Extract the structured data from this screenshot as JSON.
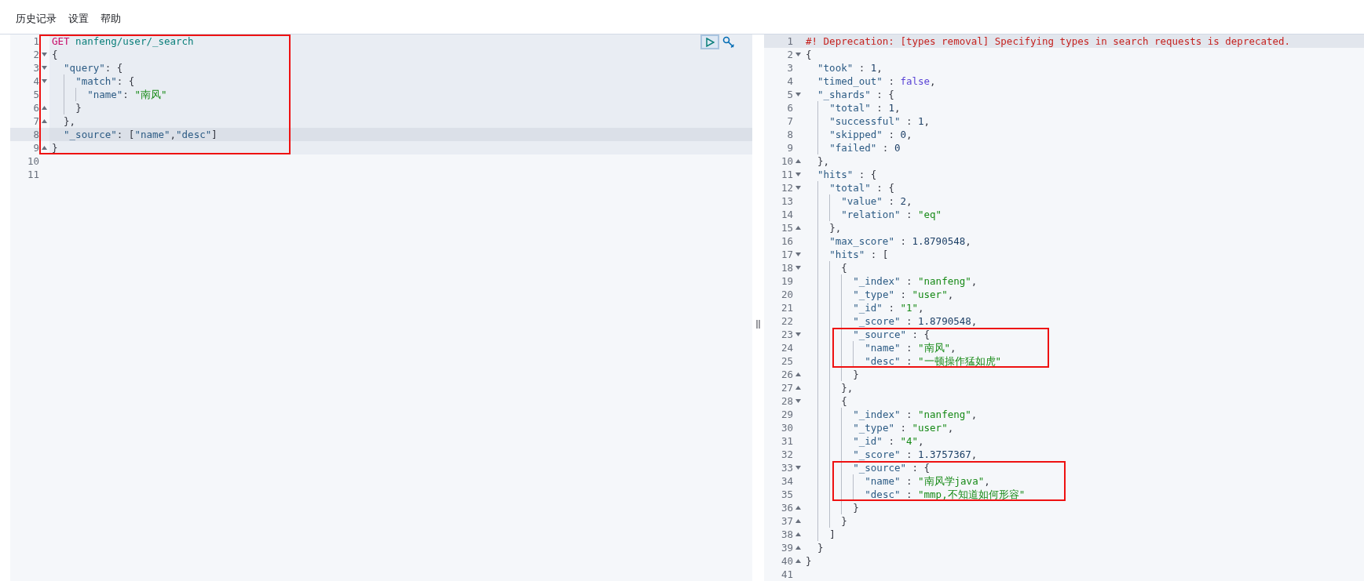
{
  "menu": [
    {
      "label": "历史记录"
    },
    {
      "label": "设置"
    },
    {
      "label": "帮助"
    }
  ],
  "request_panel": {
    "lines": [
      {
        "kind": "framed_group",
        "lines": [
          {
            "kind": "line",
            "number": "1",
            "fold_start": false,
            "fold_end": false,
            "active_block": true,
            "cursor": false,
            "tokens": [
              {
                "kind": "method",
                "text": "GET"
              },
              {
                "kind": "url",
                "text": " nanfeng/user/_search"
              }
            ]
          },
          {
            "kind": "line",
            "number": "2",
            "fold_start": true,
            "fold_end": false,
            "active_block": true,
            "cursor": false,
            "tokens": [
              {
                "kind": "punct",
                "text": "{"
              }
            ]
          },
          {
            "kind": "line",
            "number": "3",
            "fold_start": true,
            "fold_end": false,
            "active_block": true,
            "cursor": false,
            "tokens": [
              {
                "kind": "key",
                "text": "\"query\""
              },
              {
                "kind": "punct",
                "text": ": {"
              }
            ]
          },
          {
            "kind": "line",
            "number": "4",
            "fold_start": true,
            "fold_end": false,
            "active_block": true,
            "cursor": false,
            "tokens": [
              {
                "kind": "key",
                "text": "\"match\""
              },
              {
                "kind": "punct",
                "text": ": {"
              }
            ]
          },
          {
            "kind": "line",
            "number": "5",
            "fold_start": false,
            "fold_end": false,
            "active_block": true,
            "cursor": false,
            "tokens": [
              {
                "kind": "key",
                "text": "\"name\""
              },
              {
                "kind": "punct",
                "text": ": "
              },
              {
                "kind": "string",
                "text": "\"南风\""
              }
            ]
          },
          {
            "kind": "line",
            "number": "6",
            "fold_start": false,
            "fold_end": true,
            "active_block": true,
            "cursor": false,
            "tokens": [
              {
                "kind": "punct",
                "text": "}"
              }
            ]
          },
          {
            "kind": "line",
            "number": "7",
            "fold_start": false,
            "fold_end": true,
            "active_block": true,
            "cursor": false,
            "tokens": [
              {
                "kind": "punct",
                "text": "},"
              }
            ]
          },
          {
            "kind": "line",
            "number": "8",
            "fold_start": false,
            "fold_end": false,
            "active_block": true,
            "cursor": true,
            "tokens": [
              {
                "kind": "key",
                "text": "\"_source\""
              },
              {
                "kind": "punct",
                "text": ": ["
              },
              {
                "kind": "key",
                "text": "\"name\""
              },
              {
                "kind": "punct",
                "text": ","
              },
              {
                "kind": "key",
                "text": "\"desc\""
              },
              {
                "kind": "punct",
                "text": "]"
              }
            ]
          },
          {
            "kind": "line",
            "number": "9",
            "fold_start": false,
            "fold_end": true,
            "active_block": true,
            "cursor": false,
            "tokens": [
              {
                "kind": "punct",
                "text": "}"
              }
            ]
          }
        ]
      },
      {
        "kind": "line",
        "number": "10",
        "fold_start": false,
        "fold_end": false,
        "active_block": false,
        "cursor": false
      },
      {
        "kind": "line",
        "number": "11",
        "fold_start": false,
        "fold_end": false,
        "active_block": false,
        "cursor": false
      }
    ]
  },
  "response_panel": {
    "lines": [
      {
        "kind": "line",
        "number": "1",
        "fold_start": false,
        "fold_end": false,
        "active_block": false,
        "cursor": true,
        "tokens": [
          {
            "kind": "comment",
            "text": "#! Deprecation: [types removal] Specifying types in search requests is deprecated."
          }
        ]
      },
      {
        "kind": "line",
        "number": "2",
        "fold_start": true,
        "fold_end": false,
        "active_block": false,
        "cursor": false,
        "tokens": [
          {
            "kind": "punct",
            "text": "{"
          }
        ]
      },
      {
        "kind": "line",
        "number": "3",
        "fold_start": false,
        "fold_end": false,
        "active_block": false,
        "cursor": false,
        "tokens": [
          {
            "kind": "key",
            "text": "\"took\""
          },
          {
            "kind": "punct",
            "text": " : "
          },
          {
            "kind": "number",
            "text": "1"
          },
          {
            "kind": "punct",
            "text": ","
          }
        ]
      },
      {
        "kind": "line",
        "number": "4",
        "fold_start": false,
        "fold_end": false,
        "active_block": false,
        "cursor": false,
        "tokens": [
          {
            "kind": "key",
            "text": "\"timed_out\""
          },
          {
            "kind": "punct",
            "text": " : "
          },
          {
            "kind": "bool",
            "text": "false"
          },
          {
            "kind": "punct",
            "text": ","
          }
        ]
      },
      {
        "kind": "line",
        "number": "5",
        "fold_start": true,
        "fold_end": false,
        "active_block": false,
        "cursor": false,
        "tokens": [
          {
            "kind": "key",
            "text": "\"_shards\""
          },
          {
            "kind": "punct",
            "text": " : {"
          }
        ]
      },
      {
        "kind": "line",
        "number": "6",
        "fold_start": false,
        "fold_end": false,
        "active_block": false,
        "cursor": false,
        "tokens": [
          {
            "kind": "key",
            "text": "\"total\""
          },
          {
            "kind": "punct",
            "text": " : "
          },
          {
            "kind": "number",
            "text": "1"
          },
          {
            "kind": "punct",
            "text": ","
          }
        ]
      },
      {
        "kind": "line",
        "number": "7",
        "fold_start": false,
        "fold_end": false,
        "active_block": false,
        "cursor": false,
        "tokens": [
          {
            "kind": "key",
            "text": "\"successful\""
          },
          {
            "kind": "punct",
            "text": " : "
          },
          {
            "kind": "number",
            "text": "1"
          },
          {
            "kind": "punct",
            "text": ","
          }
        ]
      },
      {
        "kind": "line",
        "number": "8",
        "fold_start": false,
        "fold_end": false,
        "active_block": false,
        "cursor": false,
        "tokens": [
          {
            "kind": "key",
            "text": "\"skipped\""
          },
          {
            "kind": "punct",
            "text": " : "
          },
          {
            "kind": "number",
            "text": "0"
          },
          {
            "kind": "punct",
            "text": ","
          }
        ]
      },
      {
        "kind": "line",
        "number": "9",
        "fold_start": false,
        "fold_end": false,
        "active_block": false,
        "cursor": false,
        "tokens": [
          {
            "kind": "key",
            "text": "\"failed\""
          },
          {
            "kind": "punct",
            "text": " : "
          },
          {
            "kind": "number",
            "text": "0"
          }
        ]
      },
      {
        "kind": "line",
        "number": "10",
        "fold_start": false,
        "fold_end": true,
        "active_block": false,
        "cursor": false,
        "tokens": [
          {
            "kind": "punct",
            "text": "},"
          }
        ]
      },
      {
        "kind": "line",
        "number": "11",
        "fold_start": true,
        "fold_end": false,
        "active_block": false,
        "cursor": false,
        "tokens": [
          {
            "kind": "key",
            "text": "\"hits\""
          },
          {
            "kind": "punct",
            "text": " : {"
          }
        ]
      },
      {
        "kind": "line",
        "number": "12",
        "fold_start": true,
        "fold_end": false,
        "active_block": false,
        "cursor": false,
        "tokens": [
          {
            "kind": "key",
            "text": "\"total\""
          },
          {
            "kind": "punct",
            "text": " : {"
          }
        ]
      },
      {
        "kind": "line",
        "number": "13",
        "fold_start": false,
        "fold_end": false,
        "active_block": false,
        "cursor": false,
        "tokens": [
          {
            "kind": "key",
            "text": "\"value\""
          },
          {
            "kind": "punct",
            "text": " : "
          },
          {
            "kind": "number",
            "text": "2"
          },
          {
            "kind": "punct",
            "text": ","
          }
        ]
      },
      {
        "kind": "line",
        "number": "14",
        "fold_start": false,
        "fold_end": false,
        "active_block": false,
        "cursor": false,
        "tokens": [
          {
            "kind": "key",
            "text": "\"relation\""
          },
          {
            "kind": "punct",
            "text": " : "
          },
          {
            "kind": "string",
            "text": "\"eq\""
          }
        ]
      },
      {
        "kind": "line",
        "number": "15",
        "fold_start": false,
        "fold_end": true,
        "active_block": false,
        "cursor": false,
        "tokens": [
          {
            "kind": "punct",
            "text": "},"
          }
        ]
      },
      {
        "kind": "line",
        "number": "16",
        "fold_start": false,
        "fold_end": false,
        "active_block": false,
        "cursor": false,
        "tokens": [
          {
            "kind": "key",
            "text": "\"max_score\""
          },
          {
            "kind": "punct",
            "text": " : "
          },
          {
            "kind": "number",
            "text": "1.8790548"
          },
          {
            "kind": "punct",
            "text": ","
          }
        ]
      },
      {
        "kind": "line",
        "number": "17",
        "fold_start": true,
        "fold_end": false,
        "active_block": false,
        "cursor": false,
        "tokens": [
          {
            "kind": "key",
            "text": "\"hits\""
          },
          {
            "kind": "punct",
            "text": " : ["
          }
        ]
      },
      {
        "kind": "line",
        "number": "18",
        "fold_start": true,
        "fold_end": false,
        "active_block": false,
        "cursor": false,
        "tokens": [
          {
            "kind": "punct",
            "text": "{"
          }
        ]
      },
      {
        "kind": "line",
        "number": "19",
        "fold_start": false,
        "fold_end": false,
        "active_block": false,
        "cursor": false,
        "tokens": [
          {
            "kind": "key",
            "text": "\"_index\""
          },
          {
            "kind": "punct",
            "text": " : "
          },
          {
            "kind": "string",
            "text": "\"nanfeng\""
          },
          {
            "kind": "punct",
            "text": ","
          }
        ]
      },
      {
        "kind": "line",
        "number": "20",
        "fold_start": false,
        "fold_end": false,
        "active_block": false,
        "cursor": false,
        "tokens": [
          {
            "kind": "key",
            "text": "\"_type\""
          },
          {
            "kind": "punct",
            "text": " : "
          },
          {
            "kind": "string",
            "text": "\"user\""
          },
          {
            "kind": "punct",
            "text": ","
          }
        ]
      },
      {
        "kind": "line",
        "number": "21",
        "fold_start": false,
        "fold_end": false,
        "active_block": false,
        "cursor": false,
        "tokens": [
          {
            "kind": "key",
            "text": "\"_id\""
          },
          {
            "kind": "punct",
            "text": " : "
          },
          {
            "kind": "string",
            "text": "\"1\""
          },
          {
            "kind": "punct",
            "text": ","
          }
        ]
      },
      {
        "kind": "line",
        "number": "22",
        "fold_start": false,
        "fold_end": false,
        "active_block": false,
        "cursor": false,
        "tokens": [
          {
            "kind": "key",
            "text": "\"_score\""
          },
          {
            "kind": "punct",
            "text": " : "
          },
          {
            "kind": "number",
            "text": "1.8790548"
          },
          {
            "kind": "punct",
            "text": ","
          }
        ]
      },
      {
        "kind": "framed_group",
        "lines": [
          {
            "kind": "line",
            "number": "23",
            "fold_start": true,
            "fold_end": false,
            "active_block": false,
            "cursor": false,
            "tokens": [
              {
                "kind": "key",
                "text": "\"_source\""
              },
              {
                "kind": "punct",
                "text": " : {"
              }
            ]
          },
          {
            "kind": "line",
            "number": "24",
            "fold_start": false,
            "fold_end": false,
            "active_block": false,
            "cursor": false,
            "tokens": [
              {
                "kind": "key",
                "text": "\"name\""
              },
              {
                "kind": "punct",
                "text": " : "
              },
              {
                "kind": "string",
                "text": "\"南风\""
              },
              {
                "kind": "punct",
                "text": ","
              }
            ]
          },
          {
            "kind": "line",
            "number": "25",
            "fold_start": false,
            "fold_end": false,
            "active_block": false,
            "cursor": false,
            "tokens": [
              {
                "kind": "key",
                "text": "\"desc\""
              },
              {
                "kind": "punct",
                "text": " : "
              },
              {
                "kind": "string",
                "text": "\"一顿操作猛如虎\""
              }
            ]
          }
        ]
      },
      {
        "kind": "line",
        "number": "26",
        "fold_start": false,
        "fold_end": true,
        "active_block": false,
        "cursor": false,
        "tokens": [
          {
            "kind": "punct",
            "text": "}"
          }
        ]
      },
      {
        "kind": "line",
        "number": "27",
        "fold_start": false,
        "fold_end": true,
        "active_block": false,
        "cursor": false,
        "tokens": [
          {
            "kind": "punct",
            "text": "},"
          }
        ]
      },
      {
        "kind": "line",
        "number": "28",
        "fold_start": true,
        "fold_end": false,
        "active_block": false,
        "cursor": false,
        "tokens": [
          {
            "kind": "punct",
            "text": "{"
          }
        ]
      },
      {
        "kind": "line",
        "number": "29",
        "fold_start": false,
        "fold_end": false,
        "active_block": false,
        "cursor": false,
        "tokens": [
          {
            "kind": "key",
            "text": "\"_index\""
          },
          {
            "kind": "punct",
            "text": " : "
          },
          {
            "kind": "string",
            "text": "\"nanfeng\""
          },
          {
            "kind": "punct",
            "text": ","
          }
        ]
      },
      {
        "kind": "line",
        "number": "30",
        "fold_start": false,
        "fold_end": false,
        "active_block": false,
        "cursor": false,
        "tokens": [
          {
            "kind": "key",
            "text": "\"_type\""
          },
          {
            "kind": "punct",
            "text": " : "
          },
          {
            "kind": "string",
            "text": "\"user\""
          },
          {
            "kind": "punct",
            "text": ","
          }
        ]
      },
      {
        "kind": "line",
        "number": "31",
        "fold_start": false,
        "fold_end": false,
        "active_block": false,
        "cursor": false,
        "tokens": [
          {
            "kind": "key",
            "text": "\"_id\""
          },
          {
            "kind": "punct",
            "text": " : "
          },
          {
            "kind": "string",
            "text": "\"4\""
          },
          {
            "kind": "punct",
            "text": ","
          }
        ]
      },
      {
        "kind": "line",
        "number": "32",
        "fold_start": false,
        "fold_end": false,
        "active_block": false,
        "cursor": false,
        "tokens": [
          {
            "kind": "key",
            "text": "\"_score\""
          },
          {
            "kind": "punct",
            "text": " : "
          },
          {
            "kind": "number",
            "text": "1.3757367"
          },
          {
            "kind": "punct",
            "text": ","
          }
        ]
      },
      {
        "kind": "framed_group",
        "lines": [
          {
            "kind": "line",
            "number": "33",
            "fold_start": true,
            "fold_end": false,
            "active_block": false,
            "cursor": false,
            "tokens": [
              {
                "kind": "key",
                "text": "\"_source\""
              },
              {
                "kind": "punct",
                "text": " : {"
              }
            ]
          },
          {
            "kind": "line",
            "number": "34",
            "fold_start": false,
            "fold_end": false,
            "active_block": false,
            "cursor": false,
            "tokens": [
              {
                "kind": "key",
                "text": "\"name\""
              },
              {
                "kind": "punct",
                "text": " : "
              },
              {
                "kind": "string",
                "text": "\"南风学java\""
              },
              {
                "kind": "punct",
                "text": ","
              }
            ]
          },
          {
            "kind": "line",
            "number": "35",
            "fold_start": false,
            "fold_end": false,
            "active_block": false,
            "cursor": false,
            "tokens": [
              {
                "kind": "key",
                "text": "\"desc\""
              },
              {
                "kind": "punct",
                "text": " : "
              },
              {
                "kind": "string",
                "text": "\"mmp,不知道如何形容\""
              }
            ]
          }
        ]
      },
      {
        "kind": "line",
        "number": "36",
        "fold_start": false,
        "fold_end": true,
        "active_block": false,
        "cursor": false,
        "tokens": [
          {
            "kind": "punct",
            "text": "}"
          }
        ]
      },
      {
        "kind": "line",
        "number": "37",
        "fold_start": false,
        "fold_end": true,
        "active_block": false,
        "cursor": false,
        "tokens": [
          {
            "kind": "punct",
            "text": "}"
          }
        ]
      },
      {
        "kind": "line",
        "number": "38",
        "fold_start": false,
        "fold_end": true,
        "active_block": false,
        "cursor": false,
        "tokens": [
          {
            "kind": "punct",
            "text": "]"
          }
        ]
      },
      {
        "kind": "line",
        "number": "39",
        "fold_start": false,
        "fold_end": true,
        "active_block": false,
        "cursor": false,
        "tokens": [
          {
            "kind": "punct",
            "text": "}"
          }
        ]
      },
      {
        "kind": "line",
        "number": "40",
        "fold_start": false,
        "fold_end": true,
        "active_block": false,
        "cursor": false,
        "tokens": [
          {
            "kind": "punct",
            "text": "}"
          }
        ]
      },
      {
        "kind": "line",
        "number": "41",
        "fold_start": false,
        "fold_end": false,
        "active_block": false,
        "cursor": false
      }
    ]
  }
}
